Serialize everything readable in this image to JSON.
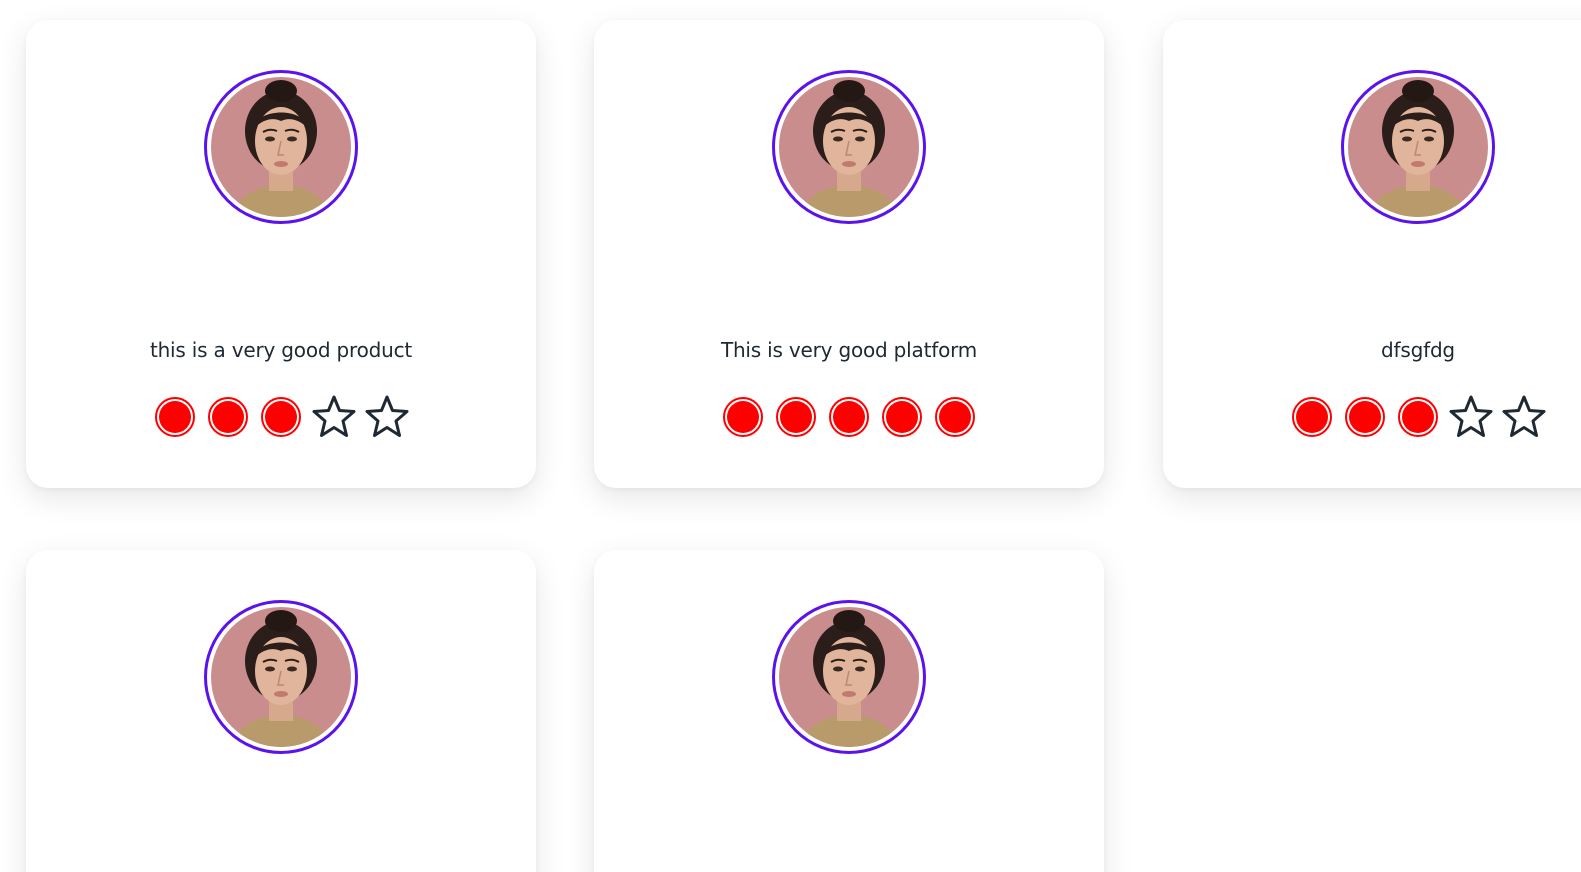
{
  "colors": {
    "avatar_ring": "#5b13ec",
    "filled_rating": "#ff0000",
    "empty_star_stroke": "#1f2933",
    "text": "#1f2933"
  },
  "reviews": [
    {
      "text": "this is a very good product",
      "rating": 3,
      "max_rating": 5
    },
    {
      "text": "This is very good platform",
      "rating": 5,
      "max_rating": 5
    },
    {
      "text": "dfsgfdg",
      "rating": 3,
      "max_rating": 5
    },
    {
      "text": "",
      "rating": null,
      "max_rating": 5
    },
    {
      "text": "",
      "rating": null,
      "max_rating": 5
    }
  ]
}
